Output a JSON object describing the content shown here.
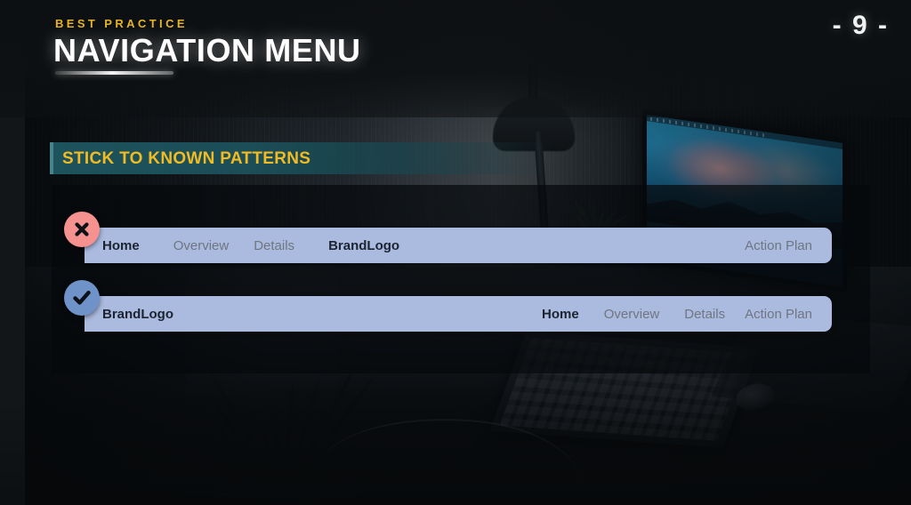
{
  "header": {
    "kicker": "BEST PRACTICE",
    "title": "NAVIGATION MENU",
    "page_number": "- 9 -"
  },
  "section": {
    "label": "STICK TO KNOWN PATTERNS"
  },
  "examples": [
    {
      "status": "incorrect",
      "status_icon": "cross-circle-icon",
      "icon_color": "#F5918F",
      "bar_color": "#ABBBE0",
      "items": [
        {
          "label": "Home",
          "style": "active"
        },
        {
          "label": "Overview",
          "style": "muted"
        },
        {
          "label": "Details",
          "style": "muted"
        },
        {
          "label": "BrandLogo",
          "style": "brand"
        },
        {
          "label": "Action Plan",
          "style": "muted"
        }
      ]
    },
    {
      "status": "correct",
      "status_icon": "check-circle-icon",
      "icon_color": "#6F92C8",
      "bar_color": "#ABBBE0",
      "items": [
        {
          "label": "BrandLogo",
          "style": "brand"
        },
        {
          "label": "Home",
          "style": "active"
        },
        {
          "label": "Overview",
          "style": "muted"
        },
        {
          "label": "Details",
          "style": "muted"
        },
        {
          "label": "Action Plan",
          "style": "muted"
        }
      ]
    }
  ],
  "theme": {
    "accent_gold": "#E6B229",
    "section_gold": "#F0BB23",
    "teal_bar": "#1E5660",
    "background": "#0D1012"
  }
}
